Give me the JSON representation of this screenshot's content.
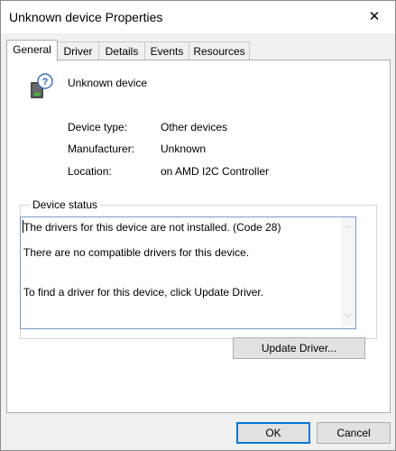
{
  "window": {
    "title": "Unknown device Properties"
  },
  "tabs": [
    {
      "label": "General"
    },
    {
      "label": "Driver"
    },
    {
      "label": "Details"
    },
    {
      "label": "Events"
    },
    {
      "label": "Resources"
    }
  ],
  "device": {
    "name": "Unknown device",
    "icon": "unknown-device-icon",
    "properties": [
      {
        "label": "Device type:",
        "value": "Other devices"
      },
      {
        "label": "Manufacturer:",
        "value": "Unknown"
      },
      {
        "label": "Location:",
        "value": "on AMD I2C Controller"
      }
    ]
  },
  "status": {
    "legend": "Device status",
    "lines": [
      "The drivers for this device are not installed. (Code 28)",
      "There are no compatible drivers for this device.",
      "To find a driver for this device, click Update Driver."
    ]
  },
  "buttons": {
    "update_driver": "Update Driver...",
    "ok": "OK",
    "cancel": "Cancel"
  }
}
